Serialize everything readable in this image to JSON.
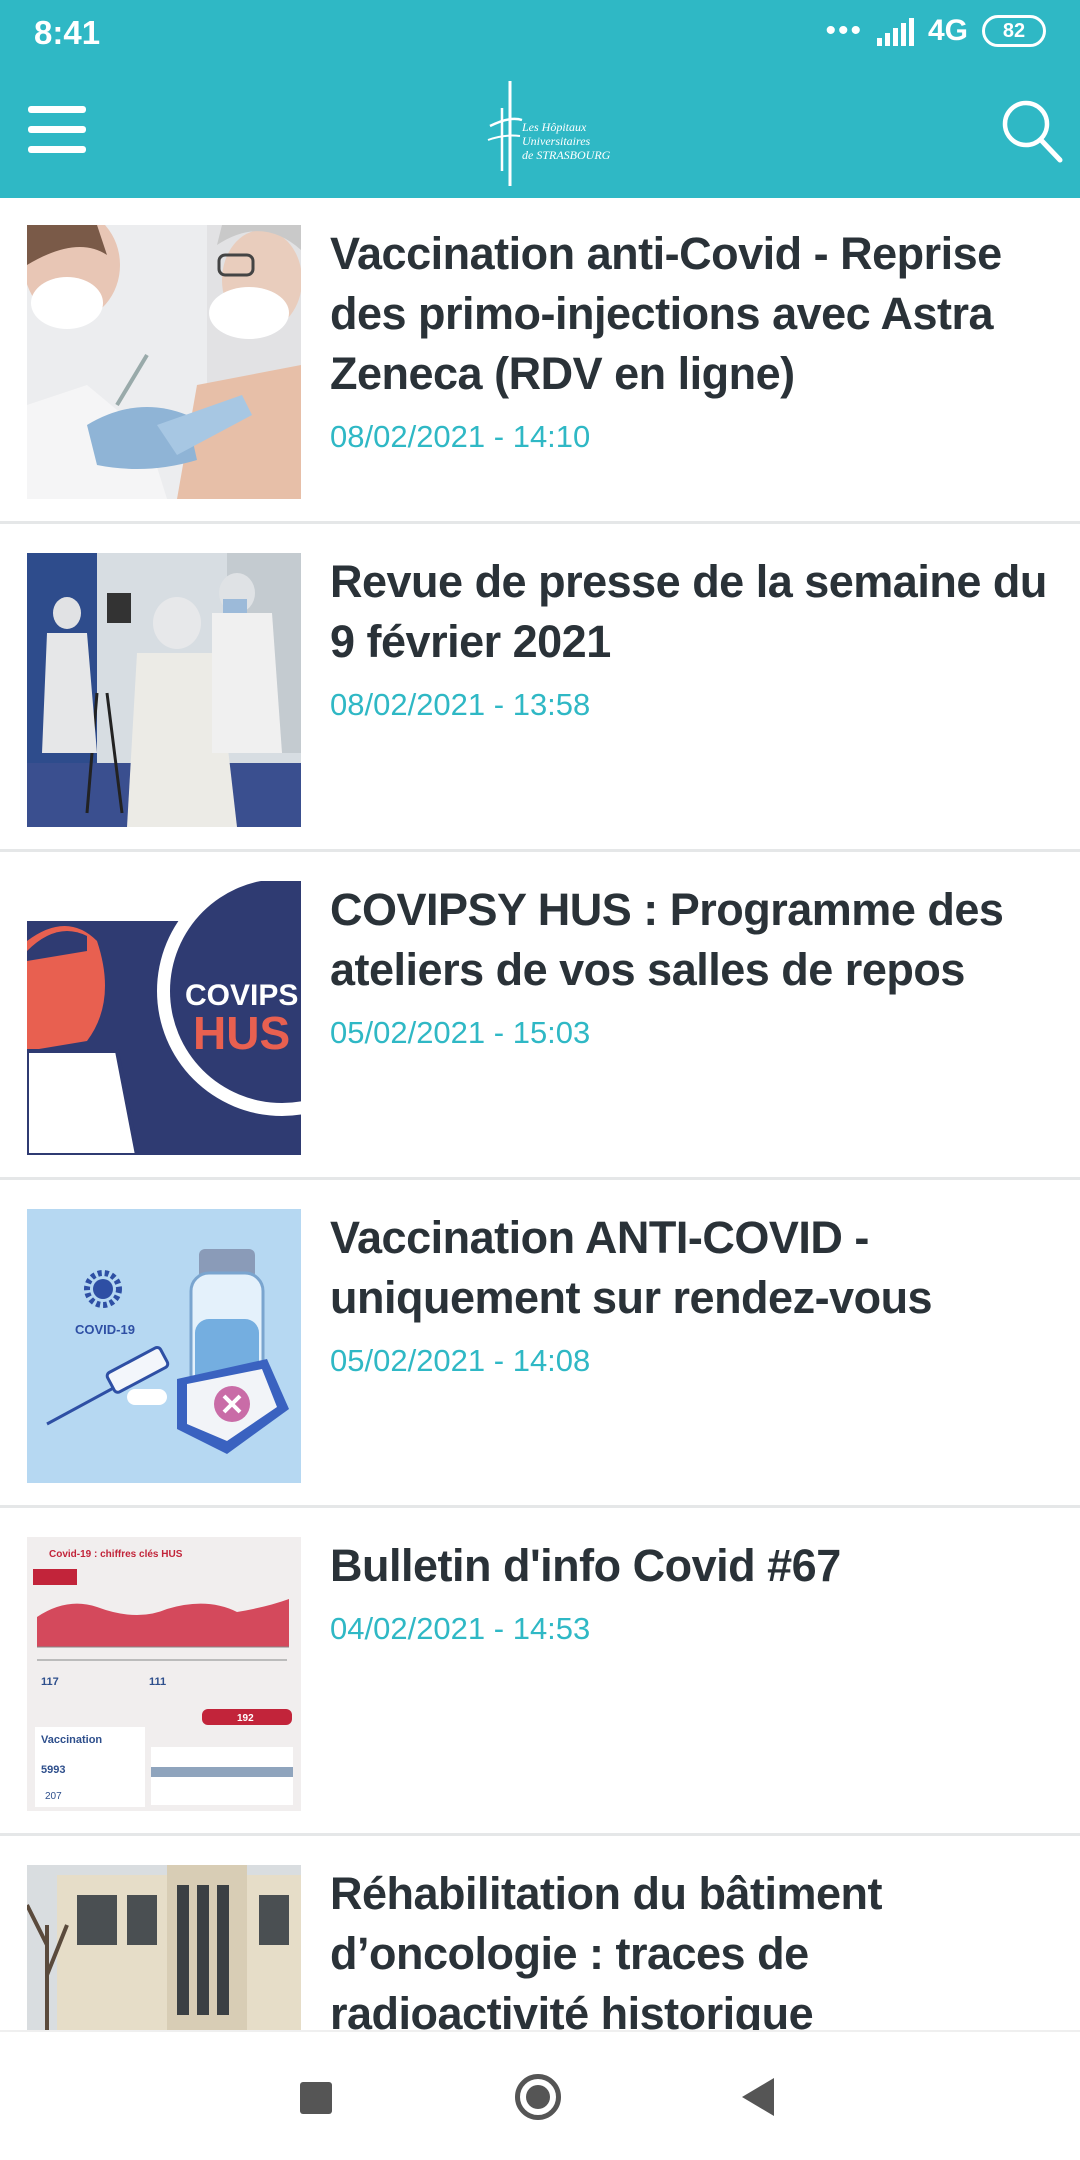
{
  "status_bar": {
    "time": "8:41",
    "dots": "•••",
    "network": "4G",
    "battery": "82"
  },
  "header": {
    "logo_line1": "Les Hôpitaux",
    "logo_line2": "Universitaires",
    "logo_line3": "de STRASBOURG",
    "menu_icon": "hamburger-menu-icon",
    "search_icon": "search-icon",
    "color": "#2fb8c5"
  },
  "news": [
    {
      "title": "Vaccination anti-Covid - Reprise des primo-injections avec Astra Zeneca (RDV en ligne)",
      "date": "08/02/2021 - 14:10"
    },
    {
      "title": "Revue de presse de la semaine du 9 février 2021",
      "date": "08/02/2021 - 13:58"
    },
    {
      "title": "COVIPSY HUS : Programme des ateliers de vos salles de repos",
      "date": "05/02/2021 - 15:03"
    },
    {
      "title": "Vaccination ANTI-COVID - uniquement sur rendez-vous",
      "date": "05/02/2021 - 14:08"
    },
    {
      "title": "Bulletin d'info Covid #67",
      "date": "04/02/2021 - 14:53"
    },
    {
      "title": "Réhabilitation du bâtiment d’oncologie : traces de radioactivité historique",
      "date": ""
    }
  ],
  "thumb_text": {
    "covipsy_1": "COVIPS",
    "covipsy_2": "HUS",
    "covid19": "COVID-19",
    "bulletin_title": "Covid-19 : chiffres clés HUS",
    "bulletin_vacc": "Vaccination",
    "bulletin_n1": "117",
    "bulletin_n2": "111",
    "bulletin_n3": "192",
    "bulletin_n4": "5993",
    "bulletin_n5": "207"
  },
  "nav": {
    "recents_icon": "recents-square-icon",
    "home_icon": "home-circle-icon",
    "back_icon": "back-triangle-icon"
  }
}
